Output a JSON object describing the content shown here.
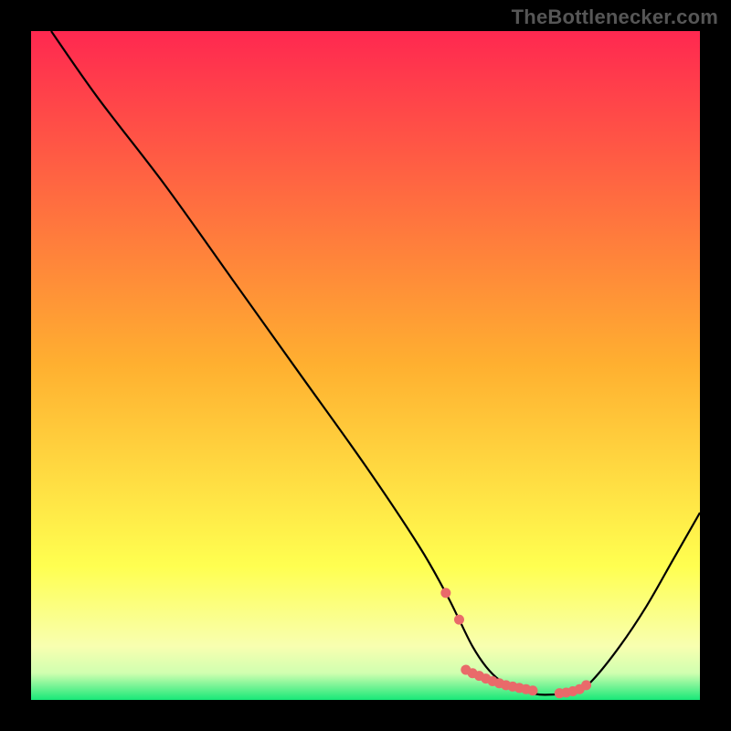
{
  "attribution": "TheBottlenecker.com",
  "chart_data": {
    "type": "line",
    "title": "",
    "xlabel": "",
    "ylabel": "",
    "xlim": [
      0,
      100
    ],
    "ylim": [
      0,
      100
    ],
    "series": [
      {
        "name": "curve",
        "x": [
          3,
          10,
          20,
          30,
          40,
          50,
          58,
          62,
          64,
          66,
          68,
          70,
          72,
          74,
          76,
          78,
          80,
          82,
          84,
          88,
          92,
          96,
          100
        ],
        "y": [
          100,
          90,
          77,
          63,
          49,
          35,
          23,
          16,
          12,
          8,
          5,
          3,
          2,
          1.2,
          0.8,
          0.8,
          1.0,
          1.5,
          3,
          8,
          14,
          21,
          28
        ]
      }
    ],
    "markers": {
      "name": "highlight-dots",
      "color": "#e96a6a",
      "x": [
        62,
        64,
        65,
        66,
        67,
        68,
        69,
        70,
        71,
        72,
        73,
        74,
        75,
        79,
        80,
        81,
        82,
        83
      ],
      "y": [
        16,
        12,
        4.5,
        4.0,
        3.6,
        3.2,
        2.8,
        2.5,
        2.2,
        2.0,
        1.8,
        1.6,
        1.4,
        1.0,
        1.1,
        1.3,
        1.6,
        2.2
      ]
    },
    "background_gradient": {
      "stops": [
        {
          "offset": 0.0,
          "color": "#ff2850"
        },
        {
          "offset": 0.5,
          "color": "#ffb030"
        },
        {
          "offset": 0.8,
          "color": "#ffff50"
        },
        {
          "offset": 0.92,
          "color": "#f8ffb0"
        },
        {
          "offset": 0.96,
          "color": "#d0ffb0"
        },
        {
          "offset": 1.0,
          "color": "#18e878"
        }
      ]
    }
  }
}
